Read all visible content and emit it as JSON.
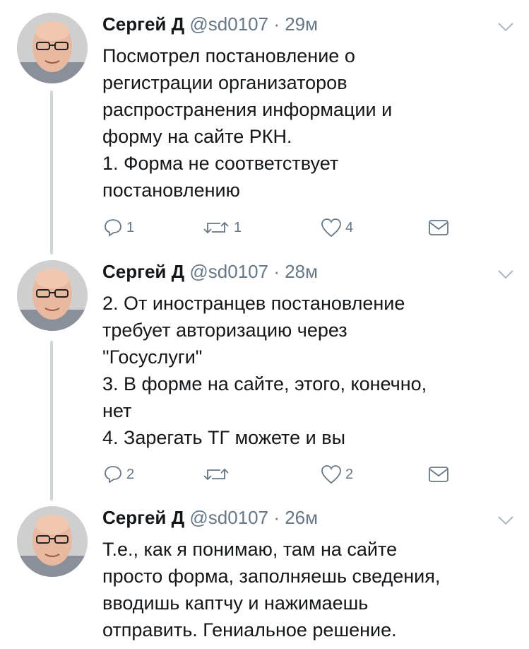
{
  "tweets": [
    {
      "name": "Сергей Д",
      "handle": "@sd0107",
      "separator": "·",
      "time": "29м",
      "text": "Посмотрел постановление о\nрегистрации организаторов\nраспространения информации и\nформу на сайте РКН.\n1. Форма не соответствует\nпостановлению",
      "replies": "1",
      "retweets": "1",
      "likes": "4"
    },
    {
      "name": "Сергей Д",
      "handle": "@sd0107",
      "separator": "·",
      "time": "28м",
      "text": "2. От иностранцев постановление\nтребует авторизацию через\n\"Госуслуги\"\n3. В форме на сайте, этого, конечно,\nнет\n4. Зарегать ТГ можете и вы",
      "replies": "2",
      "retweets": "",
      "likes": "2"
    },
    {
      "name": "Сергей Д",
      "handle": "@sd0107",
      "separator": "·",
      "time": "26м",
      "text": "Т.е., как я понимаю, там на сайте\nпросто форма, заполняешь сведения,\nвводишь каптчу и нажимаешь\nотправить. Гениальное решение."
    }
  ],
  "icons": {
    "reply": "reply-icon",
    "retweet": "retweet-icon",
    "like": "heart-icon",
    "message": "envelope-icon",
    "menu": "chevron-down-icon"
  },
  "colors": {
    "text": "#14171a",
    "secondary": "#657786",
    "thread_line": "#ccd6dd"
  }
}
